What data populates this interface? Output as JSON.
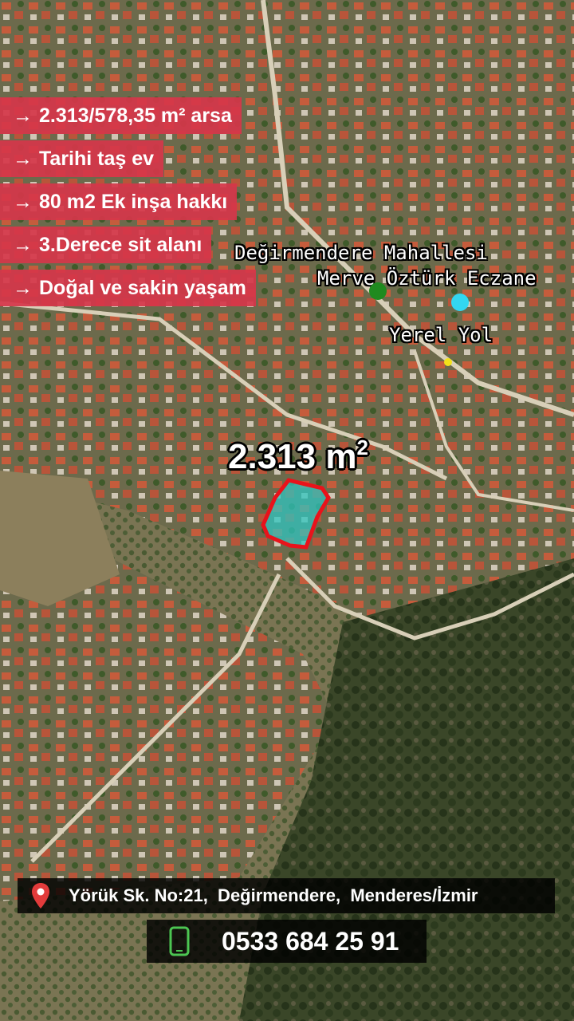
{
  "features": [
    {
      "arrow": "→",
      "text": "2.313/578,35 m² arsa"
    },
    {
      "arrow": "→",
      "text": "Tarihi taş ev"
    },
    {
      "arrow": "→",
      "text": "80 m2 Ek inşa hakkı"
    },
    {
      "arrow": "→",
      "text": "3.Derece sit alanı"
    },
    {
      "arrow": "→",
      "text": "Doğal ve sakin yaşam"
    }
  ],
  "map_labels": {
    "neighborhood": "Değirmendere Mahallesi",
    "pharmacy": "Merve Öztürk Eczane",
    "road": "Yerel Yol"
  },
  "plot": {
    "area_value": "2.313 m",
    "area_unit_sup": "2",
    "outline_color": "#e8131b",
    "fill_color": "#2fc6c0"
  },
  "markers": {
    "pharmacy_color": "#1f8a1f",
    "poi_color": "#33d6f0",
    "road_color": "#f2e21a"
  },
  "contact": {
    "address": "Yörük Sk. No:21,  Değirmendere,  Menderes/İzmir",
    "phone": "0533 684 25 91",
    "pin_icon": "location-pin-icon",
    "phone_icon": "mobile-phone-icon"
  }
}
